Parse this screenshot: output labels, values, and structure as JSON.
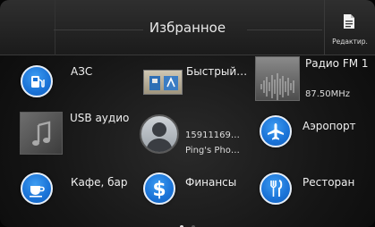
{
  "header": {
    "title": "Избранное",
    "edit_label": "Редактир."
  },
  "items": {
    "gas_station": {
      "label": "АЗС",
      "icon": "fuel-pump-icon"
    },
    "quick_route": {
      "label": "Быстрый…",
      "icon": "gas-station-shortcut-icon"
    },
    "radio": {
      "label": "Радио FM 1",
      "frequency": "87.50MHz",
      "icon": "radio-waveform-icon"
    },
    "usb_audio": {
      "label": "USB аудио",
      "icon": "music-note-icon"
    },
    "contact": {
      "number": "15911169…",
      "device": "Ping's Pho…",
      "icon": "person-avatar-icon"
    },
    "airport": {
      "label": "Аэропорт",
      "icon": "airplane-icon"
    },
    "cafe": {
      "label": "Кафе, бар",
      "icon": "coffee-cup-icon"
    },
    "finance": {
      "label": "Финансы",
      "icon": "dollar-icon"
    },
    "restaurant": {
      "label": "Ресторан",
      "icon": "fork-knife-icon"
    }
  },
  "pagination": {
    "pages": 2,
    "current": 1
  },
  "colors": {
    "icon_blue": "#1a72d6",
    "background": "#151515",
    "text": "#f0f0f0"
  }
}
